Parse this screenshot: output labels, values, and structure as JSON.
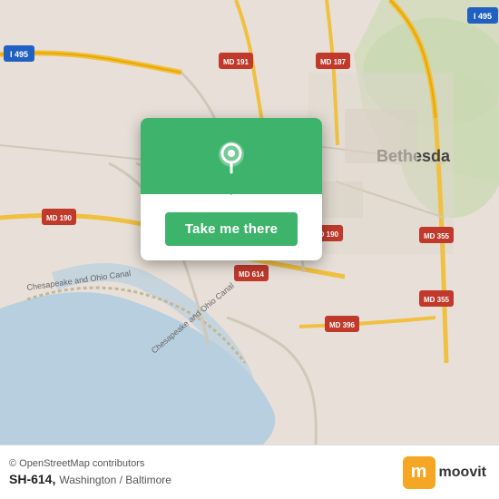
{
  "map": {
    "background_color": "#e8e0d8",
    "alt": "Map of Washington / Baltimore area showing Bethesda, MD"
  },
  "popup": {
    "button_label": "Take me there",
    "bg_color": "#3db36b",
    "icon": "location-pin"
  },
  "bottom_bar": {
    "copyright": "© OpenStreetMap contributors",
    "route_label": "SH-614,",
    "city_label": "Washington / Baltimore",
    "logo_letter": "m",
    "logo_text": "moovit"
  }
}
